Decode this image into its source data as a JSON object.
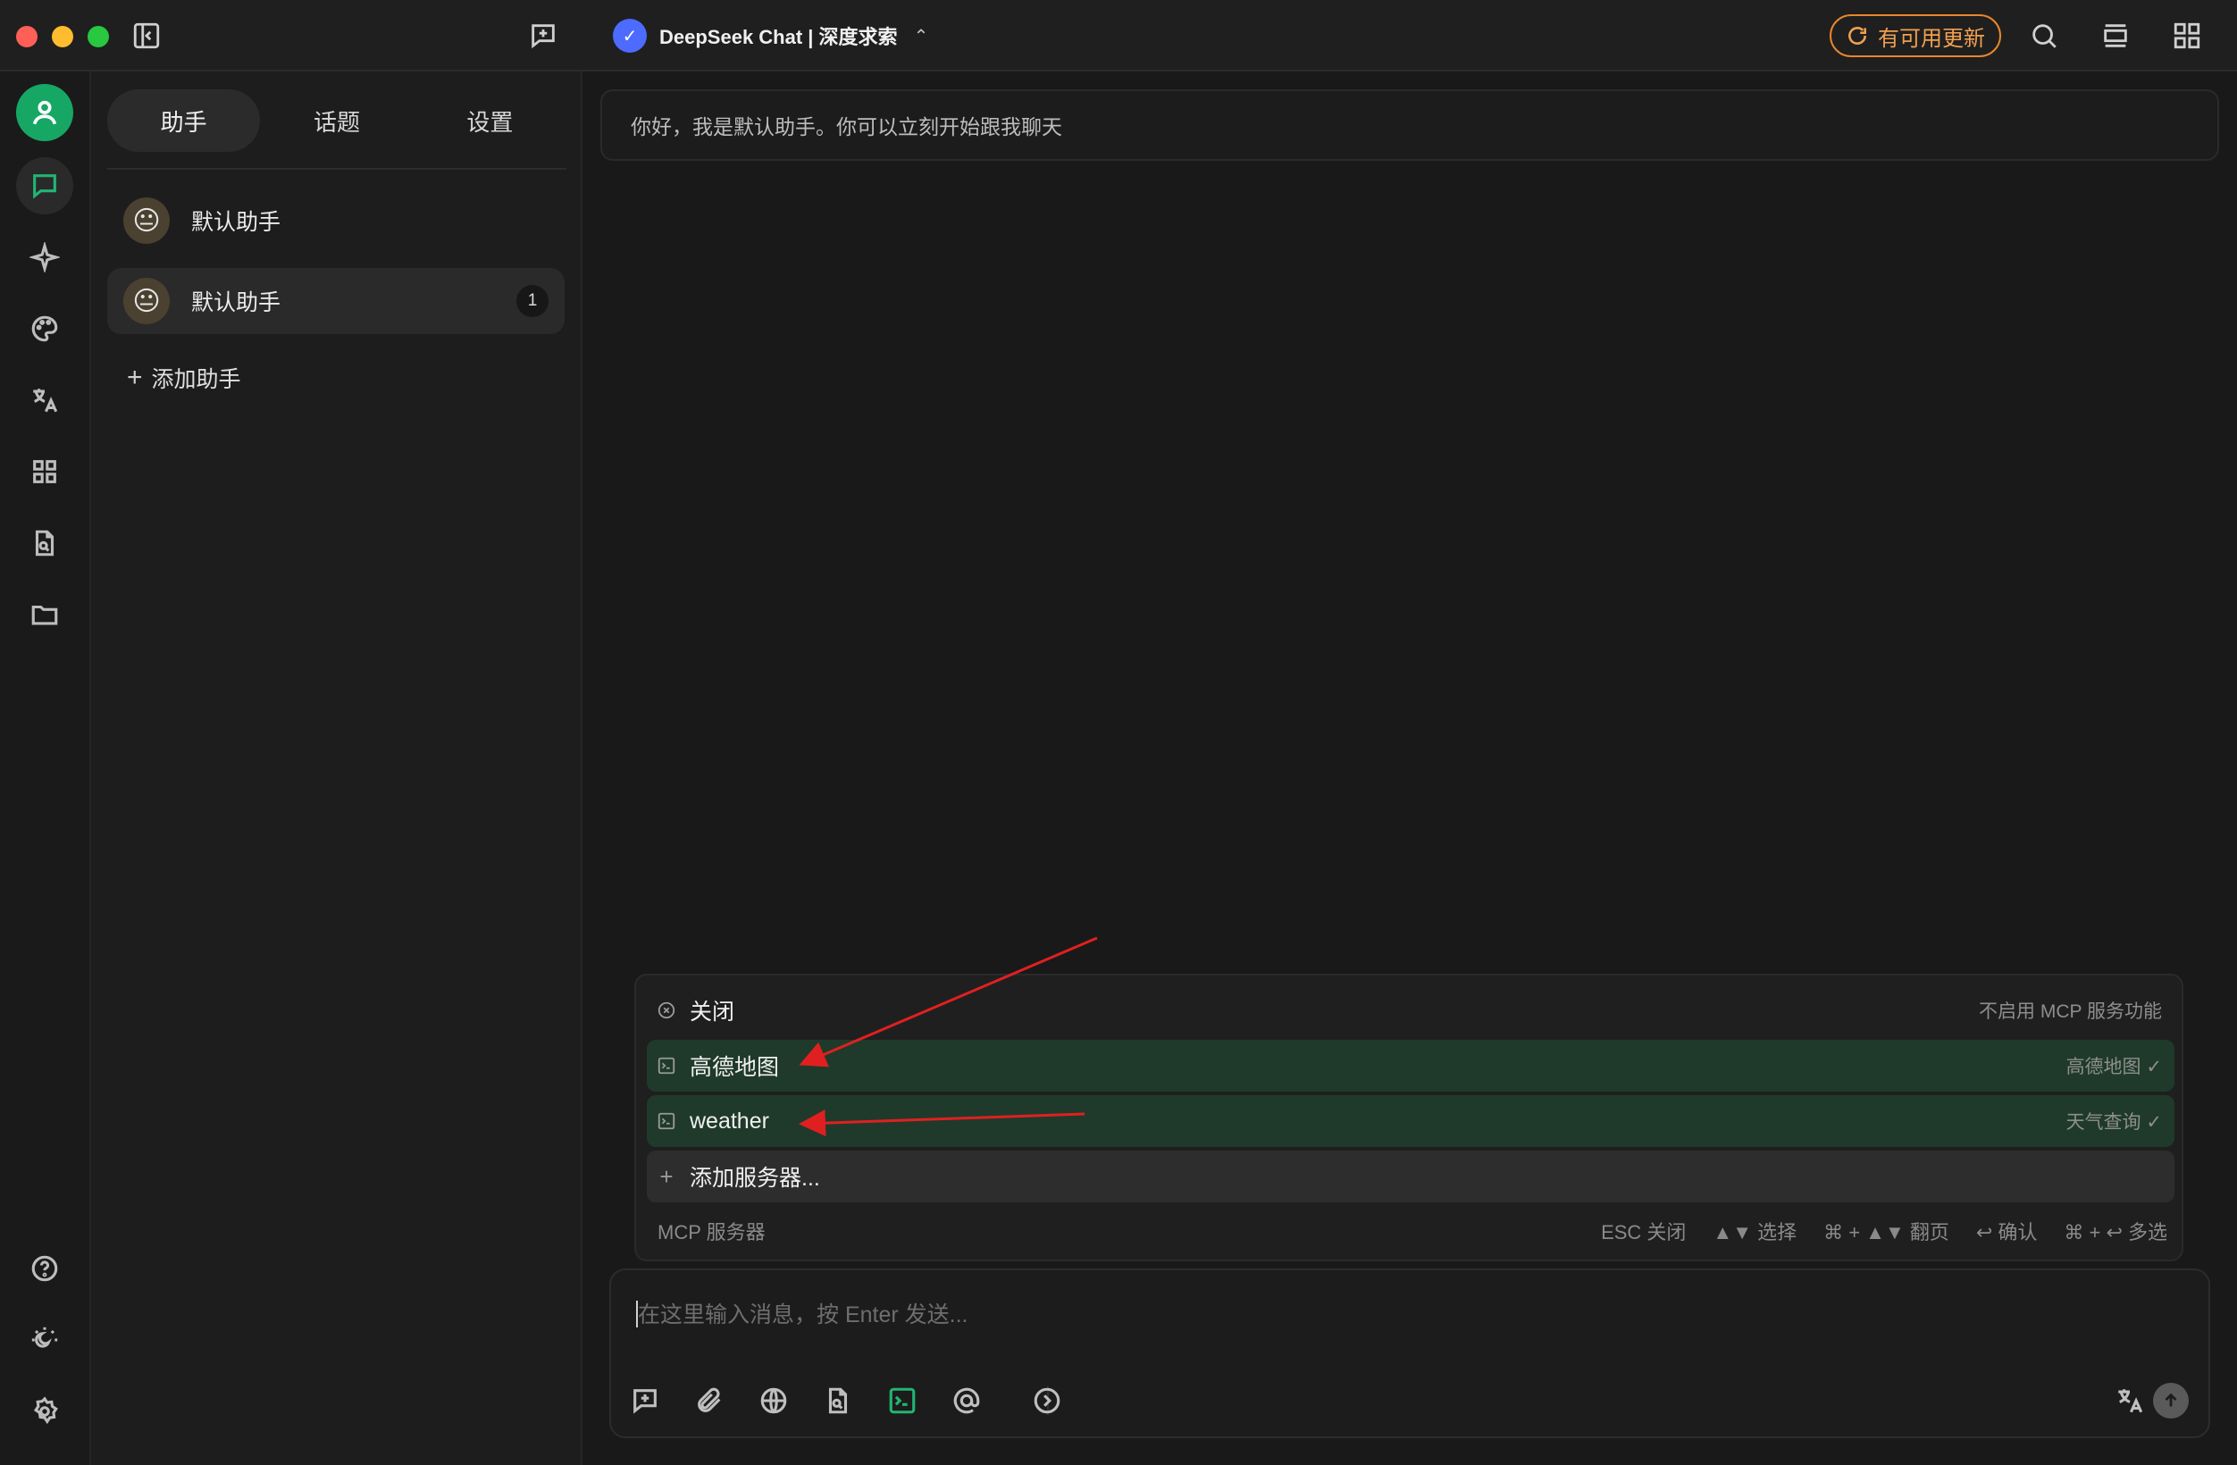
{
  "titlebar": {
    "model_logo_char": "✓",
    "model_name": "DeepSeek Chat | 深度求索",
    "update_label": "有可用更新"
  },
  "panel": {
    "tabs": [
      {
        "label": "助手",
        "active": true
      },
      {
        "label": "话题",
        "active": false
      },
      {
        "label": "设置",
        "active": false
      }
    ],
    "assistants": [
      {
        "emoji": "😐",
        "name": "默认助手",
        "badge": ""
      },
      {
        "emoji": "😐",
        "name": "默认助手",
        "badge": "1"
      }
    ],
    "add_label": "添加助手",
    "add_plus": "+"
  },
  "chat": {
    "greeting": "你好，我是默认助手。你可以立刻开始跟我聊天"
  },
  "mcp": {
    "rows": [
      {
        "label": "关闭",
        "desc": "不启用 MCP 服务功能",
        "icon": "close-circle-icon"
      },
      {
        "label": "高德地图",
        "desc": "高德地图 ✓",
        "icon": "terminal-icon"
      },
      {
        "label": "weather",
        "desc": "天气查询 ✓",
        "icon": "terminal-icon"
      },
      {
        "label": "添加服务器...",
        "desc": "",
        "icon": "plus-icon"
      }
    ],
    "add_plus": "+",
    "footer_title": "MCP 服务器",
    "hints": [
      "ESC 关闭",
      "▲▼ 选择",
      "⌘ + ▲▼ 翻页",
      "↩ 确认",
      "⌘ + ↩ 多选"
    ]
  },
  "composer": {
    "placeholder": "在这里输入消息，按 Enter 发送..."
  },
  "colors": {
    "accent": "#22b573",
    "update": "#e8862a",
    "selected_row": "#1f3a2a",
    "annotation_arrow": "#e02020"
  }
}
